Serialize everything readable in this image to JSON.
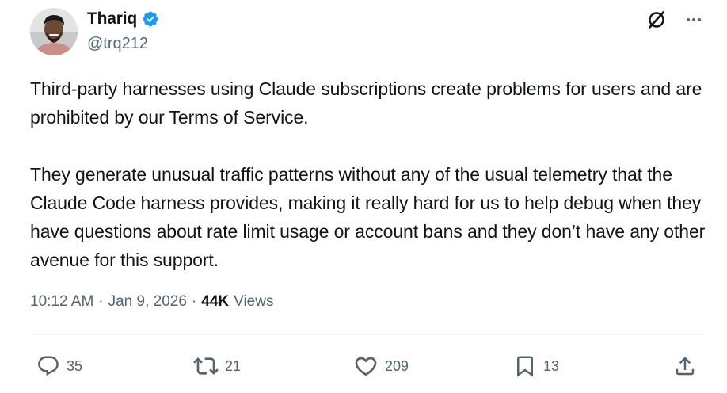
{
  "author": {
    "display_name": "Thariq",
    "handle": "@trq212",
    "verified": true,
    "verified_color": "#1d9bf0"
  },
  "top_icons": [
    "grok-icon",
    "more-icon"
  ],
  "post": {
    "paragraphs": [
      "Third-party harnesses using Claude subscriptions create problems for users and are prohibited by our Terms of Service.",
      "They generate unusual traffic patterns without any of the usual telemetry that the Claude Code harness provides, making it really hard for us to help debug when they have questions about rate limit usage or account bans and they don’t have any other avenue for this support."
    ]
  },
  "meta": {
    "time": "10:12 AM",
    "separator": "·",
    "date": "Jan 9, 2026",
    "views_count": "44K",
    "views_label": "Views"
  },
  "actions": {
    "replies": "35",
    "reposts": "21",
    "likes": "209",
    "bookmarks": "13"
  },
  "colors": {
    "text_primary": "#0f1419",
    "text_secondary": "#536471",
    "divider": "#eff3f4"
  }
}
